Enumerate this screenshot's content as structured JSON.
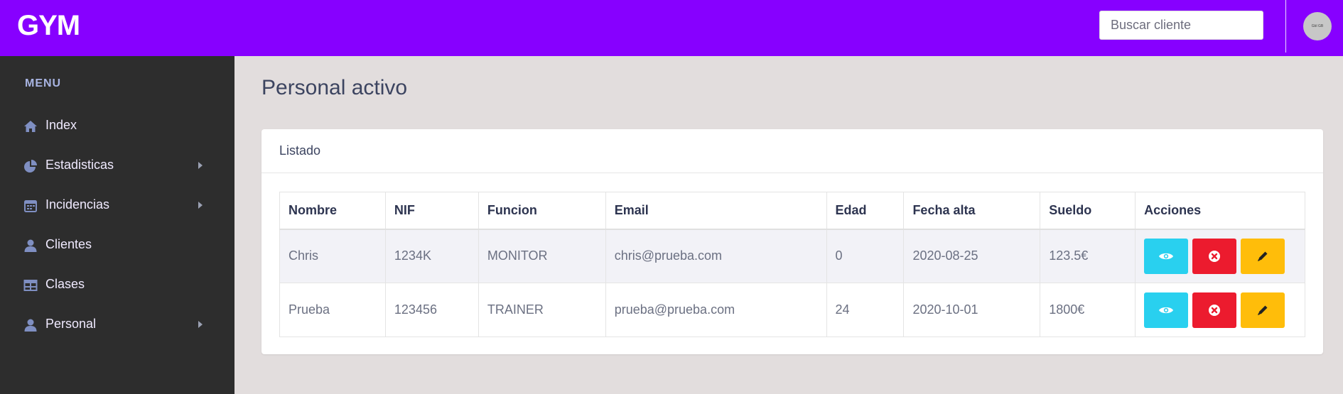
{
  "header": {
    "logo": "GYM",
    "search_placeholder": "Buscar cliente",
    "avatar_text": "Gbl GB"
  },
  "sidebar": {
    "menu_title": "MENU",
    "items": [
      {
        "label": "Index",
        "icon": "home-icon",
        "has_arrow": false
      },
      {
        "label": "Estadisticas",
        "icon": "pie-chart-icon",
        "has_arrow": true
      },
      {
        "label": "Incidencias",
        "icon": "calendar-icon",
        "has_arrow": true
      },
      {
        "label": "Clientes",
        "icon": "user-icon",
        "has_arrow": false
      },
      {
        "label": "Clases",
        "icon": "table-icon",
        "has_arrow": false
      },
      {
        "label": "Personal",
        "icon": "user-icon",
        "has_arrow": true
      }
    ]
  },
  "main": {
    "title": "Personal activo",
    "card_title": "Listado",
    "table": {
      "headers": [
        "Nombre",
        "NIF",
        "Funcion",
        "Email",
        "Edad",
        "Fecha alta",
        "Sueldo",
        "Acciones"
      ],
      "rows": [
        [
          "Chris",
          "1234K",
          "MONITOR",
          "chris@prueba.com",
          "0",
          "2020-08-25",
          "123.5€"
        ],
        [
          "Prueba",
          "123456",
          "TRAINER",
          "prueba@prueba.com",
          "24",
          "2020-10-01",
          "1800€"
        ]
      ]
    },
    "actions": [
      "eye-icon",
      "close-circle-icon",
      "pencil-icon"
    ]
  },
  "colors": {
    "topbar": "#8700ff",
    "sidebar": "#2d2d2d",
    "view_button": "#29d0ef",
    "delete_button": "#ec1b2e",
    "edit_button": "#ffbd0a"
  }
}
